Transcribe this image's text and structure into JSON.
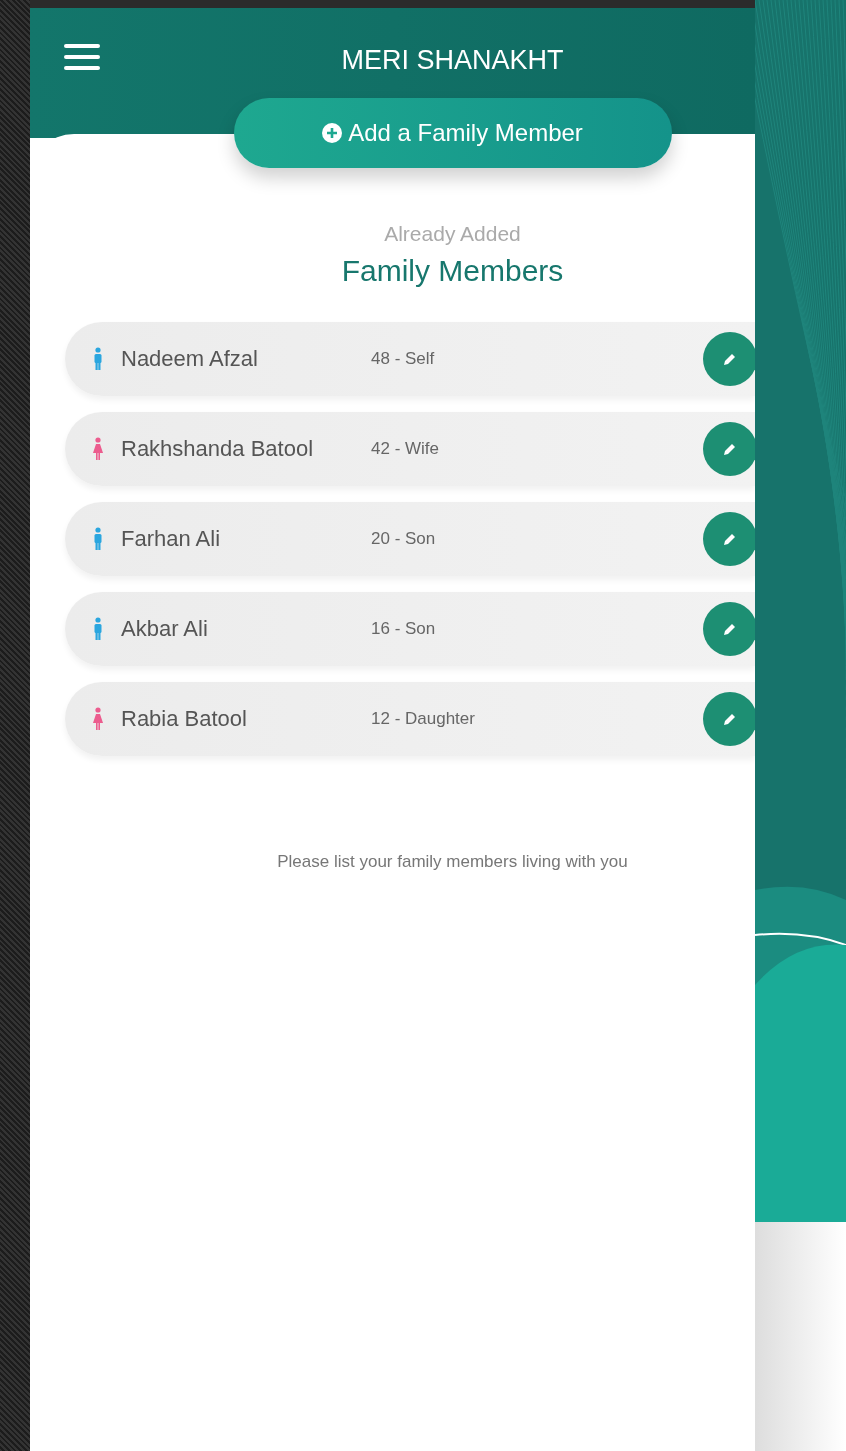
{
  "header": {
    "title": "MERI SHANAKHT"
  },
  "add_button": {
    "label": "Add a Family Member"
  },
  "section": {
    "subtitle": "Already Added",
    "title": "Family Members"
  },
  "members": [
    {
      "name": "Nadeem Afzal",
      "detail": "48 - Self",
      "kind": "male"
    },
    {
      "name": "Rakhshanda Batool",
      "detail": "42 - Wife",
      "kind": "female"
    },
    {
      "name": "Farhan Ali",
      "detail": "20 - Son",
      "kind": "male"
    },
    {
      "name": "Akbar Ali",
      "detail": "16 - Son",
      "kind": "male"
    },
    {
      "name": "Rabia Batool",
      "detail": "12 - Daughter",
      "kind": "female"
    }
  ],
  "hint": "Please list your family members living with you"
}
